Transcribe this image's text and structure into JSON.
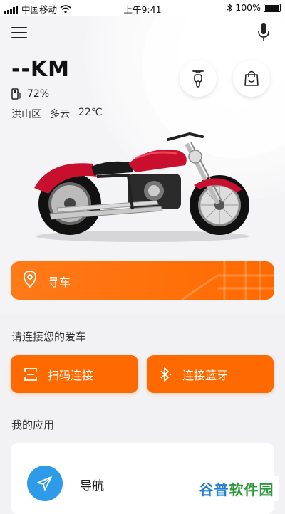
{
  "status_bar": {
    "carrier": "中国移动",
    "time": "上午9:41",
    "battery": "100%"
  },
  "dashboard": {
    "distance": "--KM",
    "fuel_percent": "72%",
    "district": "洪山区",
    "weather": "多云",
    "temperature": "22℃"
  },
  "find_car": {
    "label": "寻车"
  },
  "connect": {
    "title": "请连接您的爱车",
    "scan_label": "扫码连接",
    "bluetooth_label": "连接蓝牙"
  },
  "apps": {
    "title": "我的应用",
    "items": [
      {
        "label": "导航",
        "icon": "paper-plane-icon"
      }
    ]
  },
  "watermark": {
    "part1": "谷普",
    "part2": "软件园"
  },
  "colors": {
    "accent": "#ff6a00",
    "nav_blue": "#2d9be8",
    "bike_red": "#c8102e"
  }
}
